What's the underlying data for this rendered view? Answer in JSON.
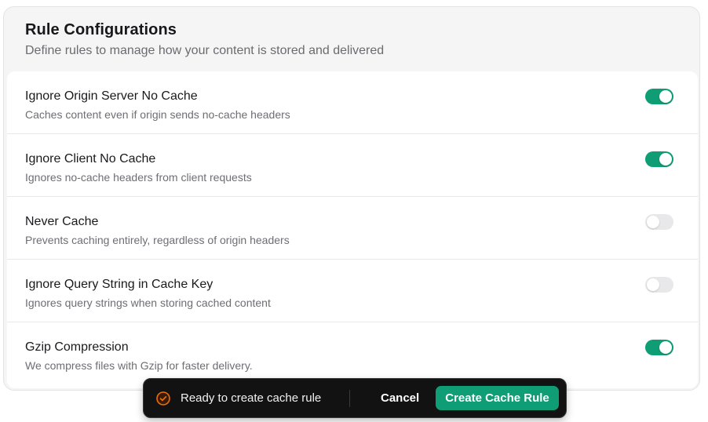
{
  "header": {
    "title": "Rule Configurations",
    "subtitle": "Define rules to manage how your content is stored and delivered"
  },
  "rules": [
    {
      "title": "Ignore Origin Server No Cache",
      "description": "Caches content even if origin sends no-cache headers",
      "enabled": true
    },
    {
      "title": "Ignore Client No Cache",
      "description": "Ignores no-cache headers from client requests",
      "enabled": true
    },
    {
      "title": "Never Cache",
      "description": "Prevents caching entirely, regardless of origin headers",
      "enabled": false
    },
    {
      "title": "Ignore Query String in Cache Key",
      "description": "Ignores query strings when storing cached content",
      "enabled": false
    },
    {
      "title": "Gzip Compression",
      "description": "We compress files with Gzip for faster delivery.",
      "enabled": true
    }
  ],
  "action_bar": {
    "status_icon": "check-circle-icon",
    "status_text": "Ready to create cache rule",
    "cancel_label": "Cancel",
    "create_label": "Create Cache Rule"
  },
  "colors": {
    "accent": "#0f9d75",
    "status_icon": "#e8700a",
    "toggle_off": "#e8e8ea",
    "action_bar_bg": "#121212"
  }
}
